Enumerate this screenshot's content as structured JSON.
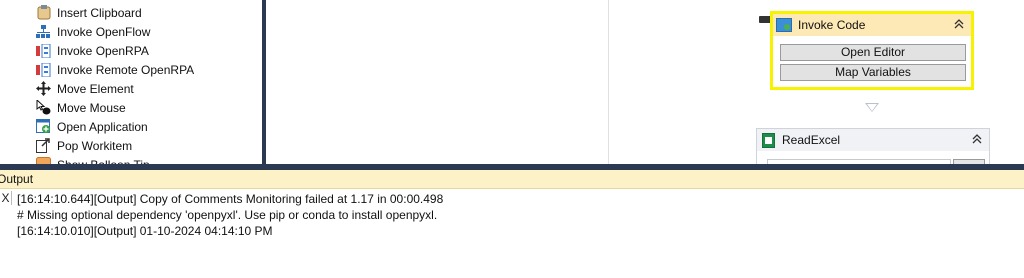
{
  "toolbox": {
    "items": [
      {
        "label": "Insert Clipboard",
        "icon": "clipboard-icon"
      },
      {
        "label": "Invoke OpenFlow",
        "icon": "flow-icon"
      },
      {
        "label": "Invoke OpenRPA",
        "icon": "openrpa-icon"
      },
      {
        "label": "Invoke Remote OpenRPA",
        "icon": "remote-openrpa-icon"
      },
      {
        "label": "Move Element",
        "icon": "move-arrows-icon"
      },
      {
        "label": "Move Mouse",
        "icon": "mouse-icon"
      },
      {
        "label": "Open Application",
        "icon": "open-application-icon"
      },
      {
        "label": "Pop Workitem",
        "icon": "pop-workitem-icon"
      },
      {
        "label": "Show Balloon Tip",
        "icon": "balloon-tip-icon"
      }
    ]
  },
  "designer": {
    "invoke_code": {
      "title": "Invoke Code",
      "open_editor_label": "Open Editor",
      "map_variables_label": "Map Variables",
      "highlight_color": "#f6f200"
    },
    "read_excel": {
      "title": "ReadExcel"
    }
  },
  "output": {
    "title": "Output",
    "close_label": "X",
    "lines": [
      "[16:14:10.644][Output] Copy of Comments Monitoring failed at 1.17 in 00:00.498",
      "# Missing optional dependency 'openpyxl'.  Use pip or conda to install openpyxl.",
      "[16:14:10.010][Output] 01-10-2024 04:14:10 PM"
    ]
  },
  "colors": {
    "splitter": "#2b3a52",
    "output_header": "#fdf1c8",
    "invoke_header": "#fde9b6"
  }
}
